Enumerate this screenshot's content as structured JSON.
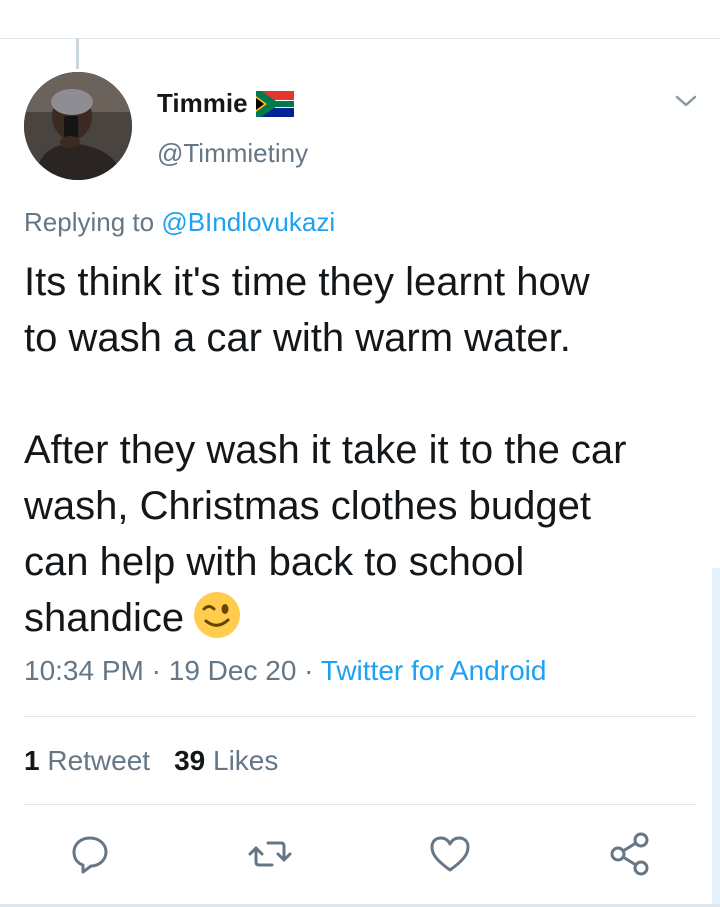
{
  "tweet": {
    "display_name": "Timmie",
    "flag_icon": "south-africa-flag-icon",
    "handle": "@Timmietiny",
    "replying_prefix": "Replying to",
    "replying_to": "@BIndlovukazi",
    "text": "Its think it's time they learnt how\nto wash a car with warm water.\n\nAfter they wash it take it to the car\nwash, Christmas clothes budget\ncan help with back to school\nshandice",
    "emoji": "winking-face-icon",
    "time": "10:34 PM",
    "sep1": " · ",
    "date": "19 Dec 20",
    "sep2": " · ",
    "source": "Twitter for Android",
    "retweet_count": "1",
    "retweet_label": "Retweet",
    "like_count": "39",
    "like_label": "Likes"
  },
  "colors": {
    "link": "#1da1f2",
    "muted": "#657786",
    "text": "#14171a",
    "divider": "#e1e8ed"
  },
  "actions": [
    "reply-icon",
    "retweet-icon",
    "like-icon",
    "share-icon"
  ]
}
